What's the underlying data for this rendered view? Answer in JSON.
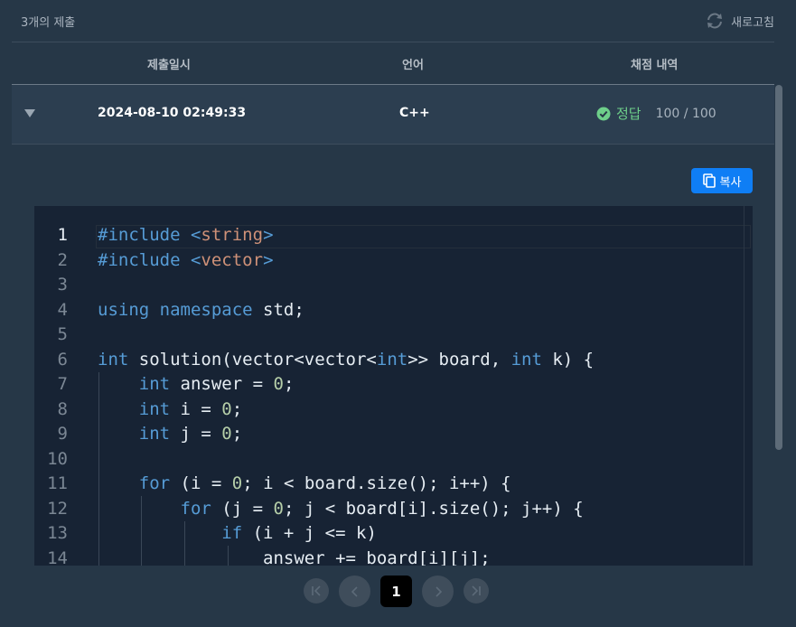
{
  "header": {
    "count_label": "3개의 제출",
    "refresh_label": "새로고침"
  },
  "columns": {
    "submitted_at": "제출일시",
    "language": "언어",
    "grading": "채점 내역"
  },
  "submission": {
    "date": "2024-08-10 02:49:33",
    "language": "C++",
    "status": "정답",
    "score": "100 / 100"
  },
  "copy_label": "복사",
  "code": {
    "line_numbers": [
      "1",
      "2",
      "3",
      "4",
      "5",
      "6",
      "7",
      "8",
      "9",
      "10",
      "11",
      "12",
      "13",
      "14"
    ],
    "tokens": [
      [
        [
          "kw",
          "#include"
        ],
        [
          "t",
          " "
        ],
        [
          "ty",
          "<"
        ],
        [
          "str",
          "string"
        ],
        [
          "ty",
          ">"
        ]
      ],
      [
        [
          "kw",
          "#include"
        ],
        [
          "t",
          " "
        ],
        [
          "ty",
          "<"
        ],
        [
          "str",
          "vector"
        ],
        [
          "ty",
          ">"
        ]
      ],
      [],
      [
        [
          "kw",
          "using"
        ],
        [
          "t",
          " "
        ],
        [
          "kw",
          "namespace"
        ],
        [
          "t",
          " std;"
        ]
      ],
      [],
      [
        [
          "ty",
          "int"
        ],
        [
          "t",
          " solution(vector<vector<"
        ],
        [
          "ty",
          "int"
        ],
        [
          "t",
          ">> board, "
        ],
        [
          "ty",
          "int"
        ],
        [
          "t",
          " k) {"
        ]
      ],
      [
        [
          "t",
          "    "
        ],
        [
          "ty",
          "int"
        ],
        [
          "t",
          " answer = "
        ],
        [
          "num",
          "0"
        ],
        [
          "t",
          ";"
        ]
      ],
      [
        [
          "t",
          "    "
        ],
        [
          "ty",
          "int"
        ],
        [
          "t",
          " i = "
        ],
        [
          "num",
          "0"
        ],
        [
          "t",
          ";"
        ]
      ],
      [
        [
          "t",
          "    "
        ],
        [
          "ty",
          "int"
        ],
        [
          "t",
          " j = "
        ],
        [
          "num",
          "0"
        ],
        [
          "t",
          ";"
        ]
      ],
      [],
      [
        [
          "t",
          "    "
        ],
        [
          "kw",
          "for"
        ],
        [
          "t",
          " (i = "
        ],
        [
          "num",
          "0"
        ],
        [
          "t",
          "; i < board.size(); i++) {"
        ]
      ],
      [
        [
          "t",
          "        "
        ],
        [
          "kw",
          "for"
        ],
        [
          "t",
          " (j = "
        ],
        [
          "num",
          "0"
        ],
        [
          "t",
          "; j < board[i].size(); j++) {"
        ]
      ],
      [
        [
          "t",
          "            "
        ],
        [
          "kw",
          "if"
        ],
        [
          "t",
          " (i + j <= k)"
        ]
      ],
      [
        [
          "t",
          "                answer += board[i][j];"
        ]
      ]
    ]
  },
  "pagination": {
    "current_page": "1"
  },
  "colors": {
    "accent": "#0f7ef5",
    "success": "#6ecf8a",
    "background": "#263747",
    "editor_bg": "#172334"
  }
}
